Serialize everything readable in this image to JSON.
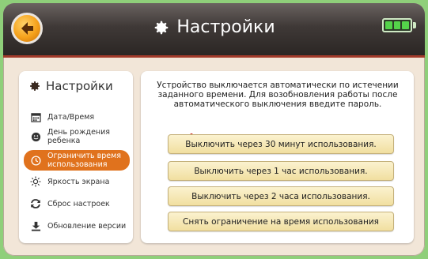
{
  "header": {
    "title": "Настройки",
    "back_icon": "arrow-left-icon",
    "settings_icon": "gear-icon",
    "battery_icon": "battery-full-icon",
    "accent": "#f5a11b",
    "bar_color": "#3f3937"
  },
  "sidebar": {
    "title": "Настройки",
    "items": [
      {
        "label": "Дата/Время",
        "icon": "calendar-icon"
      },
      {
        "label": "День рождения\nребенка",
        "icon": "smiley-icon"
      },
      {
        "label": "Ограничить время\nиспользования",
        "icon": "clock-icon",
        "active": true
      },
      {
        "label": "Яркость экрана",
        "icon": "sun-icon"
      },
      {
        "label": "Сброс настроек",
        "icon": "refresh-icon"
      },
      {
        "label": "Обновление версии",
        "icon": "download-icon"
      }
    ]
  },
  "main": {
    "description": "Устройство выключается автоматически по истечении заданного времени. Для возобновления работы после автоматического выключения введите пароль.",
    "options": [
      {
        "label": "Выключить через 30 минут использования.",
        "selected": true
      },
      {
        "label": "Выключить через 1 час использования.",
        "selected": false
      },
      {
        "label": "Выключить через 2 часа использования.",
        "selected": false
      },
      {
        "label": "Снять ограничение на время использования",
        "selected": false
      }
    ],
    "check_icon": "checkmark-icon",
    "active_color": "#e0721d"
  }
}
